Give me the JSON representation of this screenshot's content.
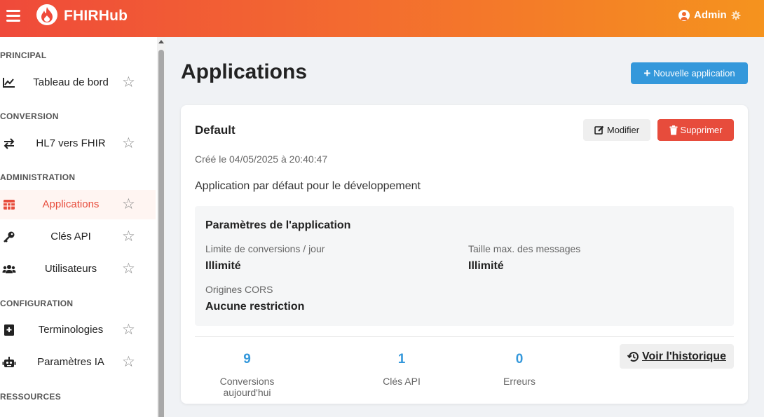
{
  "header": {
    "brand": "FHIRHub",
    "user_label": "Admin",
    "colors": {
      "gradient_start": "#ef4a3a",
      "gradient_end": "#f5931e"
    }
  },
  "sidebar": {
    "sections": {
      "principal": "PRINCIPAL",
      "conversion": "CONVERSION",
      "administration": "ADMINISTRATION",
      "configuration": "CONFIGURATION",
      "ressources": "RESSOURCES"
    },
    "items": [
      {
        "label": "Tableau de bord",
        "icon": "chart-line-icon"
      },
      {
        "label": "HL7 vers FHIR",
        "icon": "exchange-icon"
      },
      {
        "label": "Applications",
        "icon": "table-icon",
        "active": true
      },
      {
        "label": "Clés API",
        "icon": "key-icon"
      },
      {
        "label": "Utilisateurs",
        "icon": "users-icon"
      },
      {
        "label": "Terminologies",
        "icon": "book-medical-icon"
      },
      {
        "label": "Paramètres IA",
        "icon": "robot-icon"
      }
    ],
    "star_glyph": "☆"
  },
  "main": {
    "title": "Applications",
    "new_button": "Nouvelle application",
    "card": {
      "name": "Default",
      "edit_button": "Modifier",
      "delete_button": "Supprimer",
      "created": "Créé le 04/05/2025 à 20:40:47",
      "description": "Application par défaut pour le développement",
      "params": {
        "title": "Paramètres de l'application",
        "limit_label": "Limite de conversions / jour",
        "limit_value": "Illimité",
        "max_size_label": "Taille max. des messages",
        "max_size_value": "Illimité",
        "cors_label": "Origines CORS",
        "cors_value": "Aucune restriction"
      },
      "stats": [
        {
          "value": "9",
          "label": "Conversions aujourd'hui"
        },
        {
          "value": "1",
          "label": "Clés API"
        },
        {
          "value": "0",
          "label": "Erreurs"
        }
      ],
      "history_button": "Voir l'historique"
    },
    "colors": {
      "primary": "#3498db",
      "danger": "#e74c3c",
      "accent": "#e74c3c"
    }
  }
}
